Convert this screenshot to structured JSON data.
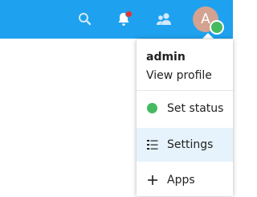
{
  "header": {
    "background_color": "#1ea1ee",
    "icons": [
      {
        "name": "search-icon"
      },
      {
        "name": "bell-icon",
        "has_notification": true,
        "notification_color": "#e9322d"
      },
      {
        "name": "contacts-icon"
      }
    ],
    "avatar": {
      "initial": "A",
      "background_color": "#d3a291",
      "status_color": "#46ba61"
    }
  },
  "user_menu": {
    "username": "admin",
    "view_profile": "View profile",
    "items": [
      {
        "label": "Set status",
        "icon": "status-dot-icon",
        "color": "#46ba61"
      },
      {
        "label": "Settings",
        "icon": "settings-list-icon",
        "active": true
      },
      {
        "label": "Apps",
        "icon": "plus-icon"
      }
    ]
  }
}
